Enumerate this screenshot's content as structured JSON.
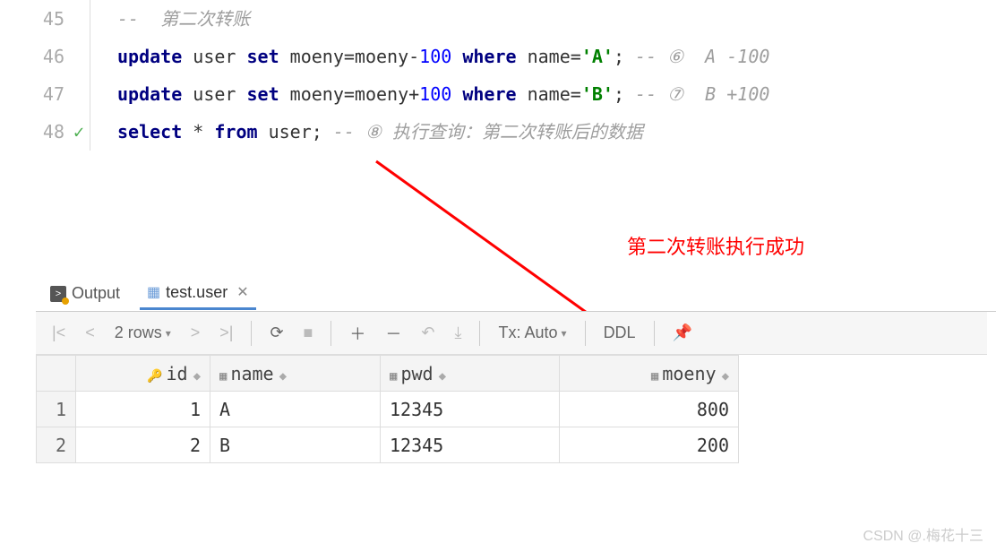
{
  "editor": {
    "lines": [
      {
        "num": "45",
        "check": false
      },
      {
        "num": "46",
        "check": false
      },
      {
        "num": "47",
        "check": false
      },
      {
        "num": "48",
        "check": true
      }
    ],
    "l45_comment": "--  第二次转账",
    "l46_kw1": "update",
    "l46_ident1": " user ",
    "l46_kw2": "set",
    "l46_ident2": " moeny=moeny",
    "l46_minus": "-",
    "l46_num": "100",
    "l46_kw3": " where ",
    "l46_ident3": "name=",
    "l46_str": "'A'",
    "l46_semi": ";",
    "l46_cm": " -- ⑥  A -100",
    "l47_kw1": "update",
    "l47_ident1": " user ",
    "l47_kw2": "set",
    "l47_ident2": " moeny=moeny+",
    "l47_num": "100",
    "l47_kw3": " where ",
    "l47_ident3": "name=",
    "l47_str": "'B'",
    "l47_semi": ";",
    "l47_cm": " -- ⑦  B +100",
    "l48_kw1": "select",
    "l48_star": " * ",
    "l48_kw2": "from",
    "l48_ident": " user;",
    "l48_cm": " -- ⑧ 执行查询：第二次转账后的数据"
  },
  "annotation": {
    "text": "第二次转账执行成功"
  },
  "tabs": {
    "output": "Output",
    "table": "test.user"
  },
  "toolbar": {
    "rowcount": "2 rows",
    "tx": "Tx: Auto",
    "ddl": "DDL"
  },
  "table": {
    "headers": {
      "id": "id",
      "name": "name",
      "pwd": "pwd",
      "moeny": "moeny"
    },
    "rows": [
      {
        "n": "1",
        "id": "1",
        "name": "A",
        "pwd": "12345",
        "moeny": "800"
      },
      {
        "n": "2",
        "id": "2",
        "name": "B",
        "pwd": "12345",
        "moeny": "200"
      }
    ]
  },
  "watermark": "CSDN @.梅花十三"
}
